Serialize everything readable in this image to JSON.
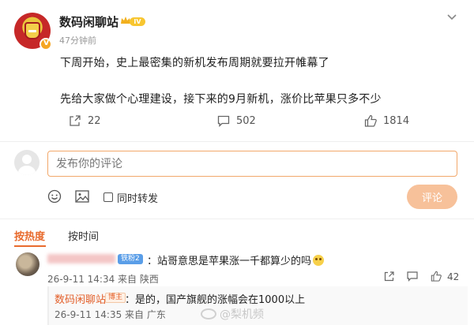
{
  "post": {
    "author": "数码闲聊站",
    "level": "IV",
    "time": "47分钟前",
    "line1": "下周开始，史上最密集的新机发布周期就要拉开帷幕了",
    "line2": "先给大家做个心理建设，接下来的9月新机，涨价比苹果只多不少",
    "share_count": "22",
    "comment_count": "502",
    "like_count": "1814"
  },
  "composer": {
    "placeholder": "发布你的评论",
    "repost_label": "同时转发",
    "submit_label": "评论"
  },
  "tabs": {
    "hot": "按热度",
    "time": "按时间"
  },
  "comment": {
    "badge": "铁粉2",
    "text": "：站哥意思是苹果涨一千都算少的吗",
    "meta": "26-9-11 14:34 来自 陕西",
    "like_count": "42"
  },
  "reply": {
    "author": "数码闲聊站",
    "badge": "博主",
    "text": "：是的，国产旗舰的涨幅会在1000以上",
    "meta": "26-9-11 14:35 来自 广东"
  },
  "watermark": "@梨机频"
}
